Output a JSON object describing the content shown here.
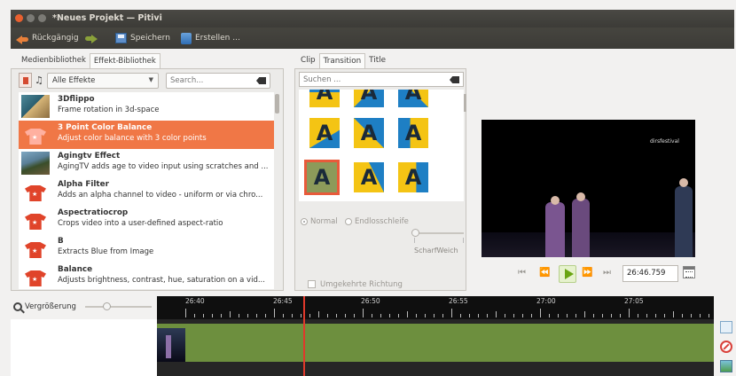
{
  "window": {
    "title": "*Neues Projekt — Pitivi"
  },
  "toolbar": {
    "undo_label": "Rückgängig",
    "save_label": "Speichern",
    "render_label": "Erstellen ..."
  },
  "left_tabs": [
    "Medienbibliothek",
    "Effekt-Bibliothek"
  ],
  "effects_filter": {
    "category": "Alle Effekte",
    "search_placeholder": "Search..."
  },
  "effects": [
    {
      "name": "3Dflippo",
      "desc": "Frame rotation in 3d-space"
    },
    {
      "name": "3 Point Color Balance",
      "desc": "Adjust color balance with 3 color points"
    },
    {
      "name": "Agingtv Effect",
      "desc": "AgingTV adds age to video input using scratches and ..."
    },
    {
      "name": "Alpha Filter",
      "desc": "Adds an alpha channel to video - uniform or via chro..."
    },
    {
      "name": "Aspectratiocrop",
      "desc": "Crops video into a user-defined aspect-ratio"
    },
    {
      "name": "B",
      "desc": "Extracts Blue from Image"
    },
    {
      "name": "Balance",
      "desc": "Adjusts brightness, contrast, hue, saturation on a vid..."
    }
  ],
  "mid_tabs": [
    "Clip",
    "Transition",
    "Title"
  ],
  "transitions": {
    "search_placeholder": "Suchen ...",
    "glyph": "A",
    "options": {
      "normal": "Normal",
      "loop": "Endlosschleife",
      "softness": "ScharfWeich",
      "reverse": "Umgekehrte Richtung"
    }
  },
  "viewer": {
    "logo_text": "dirsfestival",
    "timecode": "26:46.759"
  },
  "timeline": {
    "zoom_label": "Vergrößerung",
    "ruler_labels": [
      "26:40",
      "26:45",
      "26:50",
      "26:55",
      "27:00",
      "27:05"
    ]
  },
  "colors": {
    "accent": "#f07746",
    "clip": "#6d8f3e",
    "playhead": "#e0392b"
  }
}
